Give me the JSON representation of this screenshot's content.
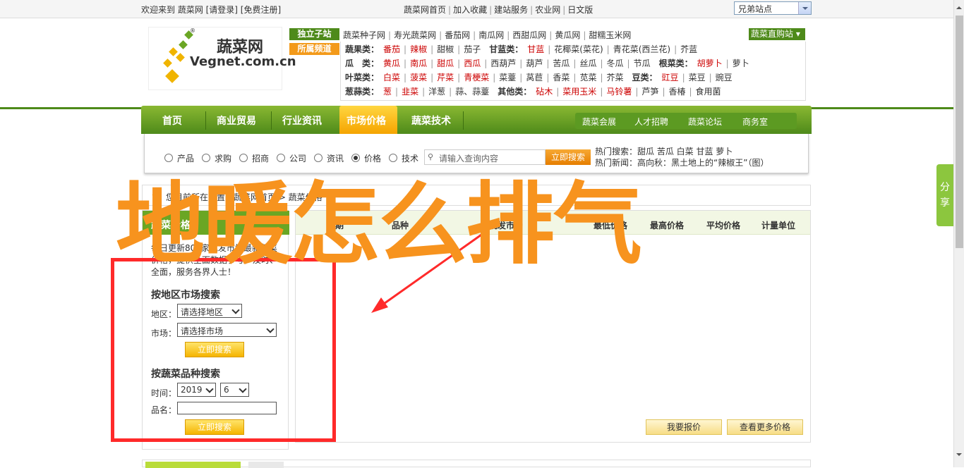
{
  "topbar": {
    "welcome": "欢迎来到 蔬菜网 [请登录] [免费注册]",
    "links": [
      "蔬菜网首页",
      "加入收藏",
      "建站服务",
      "农业网",
      "日文版"
    ],
    "site_select": "兄弟站点"
  },
  "logo": {
    "cn": "蔬菜网",
    "en": "Vegnet.com.cn",
    "reg": "®"
  },
  "header": {
    "tag1": "独立子站",
    "tag2": "所属频道",
    "sub_sites": [
      "蔬菜种子网",
      "寿光蔬菜网",
      "番茄网",
      "南瓜网",
      "西甜瓜网",
      "黄瓜网",
      "甜糯玉米网"
    ],
    "buy_button": "蔬菜直购站",
    "categories": [
      {
        "label": "蔬果类：",
        "items": [
          [
            "番茄",
            true
          ],
          [
            "辣椒",
            true
          ],
          [
            "甜椒",
            false
          ],
          [
            "茄子",
            false
          ]
        ],
        "label2": "甘蓝类：",
        "items2": [
          [
            "甘蓝",
            true
          ],
          [
            "花椰菜(菜花)",
            false
          ],
          [
            "青花菜(西兰花)",
            false
          ],
          [
            "芥蓝",
            false
          ]
        ]
      },
      {
        "label": "瓜　类：",
        "items": [
          [
            "黄瓜",
            true
          ],
          [
            "南瓜",
            true
          ],
          [
            "甜瓜",
            true
          ],
          [
            "西瓜",
            true
          ],
          [
            "西葫芦",
            false
          ],
          [
            "葫芦",
            false
          ],
          [
            "苦瓜",
            false
          ],
          [
            "丝瓜",
            false
          ],
          [
            "冬瓜",
            false
          ],
          [
            "节瓜",
            false
          ]
        ],
        "label2": "根菜类：",
        "items2": [
          [
            "胡萝卜",
            true
          ],
          [
            "萝卜",
            false
          ]
        ]
      },
      {
        "label": "叶菜类：",
        "items": [
          [
            "白菜",
            true
          ],
          [
            "菠菜",
            true
          ],
          [
            "芹菜",
            true
          ],
          [
            "青梗菜",
            true
          ],
          [
            "菜薹",
            false
          ],
          [
            "莴苣",
            false
          ],
          [
            "香菜",
            false
          ],
          [
            "苋菜",
            false
          ],
          [
            "芥菜",
            false
          ]
        ],
        "label2": "豆类：",
        "items2": [
          [
            "豇豆",
            true
          ],
          [
            "菜豆",
            false
          ],
          [
            "豌豆",
            false
          ]
        ]
      },
      {
        "label": "葱蒜类：",
        "items": [
          [
            "葱",
            true
          ],
          [
            "韭菜",
            true
          ],
          [
            "洋葱",
            false
          ],
          [
            "蒜、蒜薹",
            false
          ]
        ],
        "label2": "其他类：",
        "items2": [
          [
            "砧木",
            true
          ],
          [
            "菜用玉米",
            true
          ],
          [
            "马铃薯",
            true
          ],
          [
            "芦笋",
            false
          ],
          [
            "香椿",
            false
          ],
          [
            "食用菌",
            false
          ]
        ]
      }
    ]
  },
  "nav": {
    "items": [
      "首页",
      "商业贸易",
      "行业资讯",
      "市场价格",
      "蔬菜技术"
    ],
    "sub": [
      "蔬菜会展",
      "人才招聘",
      "蔬菜论坛",
      "商务室"
    ]
  },
  "search": {
    "options": [
      "产品",
      "求购",
      "招商",
      "公司",
      "资讯",
      "价格",
      "技术"
    ],
    "selected": "价格",
    "placeholder": "请输入查询内容",
    "button": "立即搜索",
    "hot_label": "热门搜索：",
    "hot_items": "甜瓜 苦瓜 白菜 甘蓝 萝卜",
    "news_label": "热门新闻：",
    "news_item": "高向秋：黑土地上的“辣椒王”（图）"
  },
  "breadcrumb": "您目前所在位置：蔬菜网首页 > 蔬菜价格",
  "panel": {
    "title": "蔬菜价格",
    "desc": "每日更新800家批发市场最新蔬菜价格，提供全面数据参考，及时、全面，服务各界人士！",
    "heading1": "按地区市场搜索",
    "region_label": "地区：",
    "region_value": "请选择地区",
    "market_label": "市场：",
    "market_value": "请选择市场",
    "button": "立即搜索",
    "heading2": "按蔬菜品种搜索",
    "time_label": "时间：",
    "year": "2019",
    "month": "6",
    "name_label": "品名："
  },
  "table": {
    "headers": [
      "日期",
      "品种",
      "批发市场",
      "最低价格",
      "最高价格",
      "平均价格",
      "计量单位"
    ],
    "btn_quote": "我要报价",
    "btn_more": "查看更多价格"
  },
  "overlay_text": "地暖怎么排气",
  "share": "分享",
  "colors": {
    "green": "#4e8a1a",
    "orange": "#f7931e",
    "red": "#ff2a2a"
  }
}
